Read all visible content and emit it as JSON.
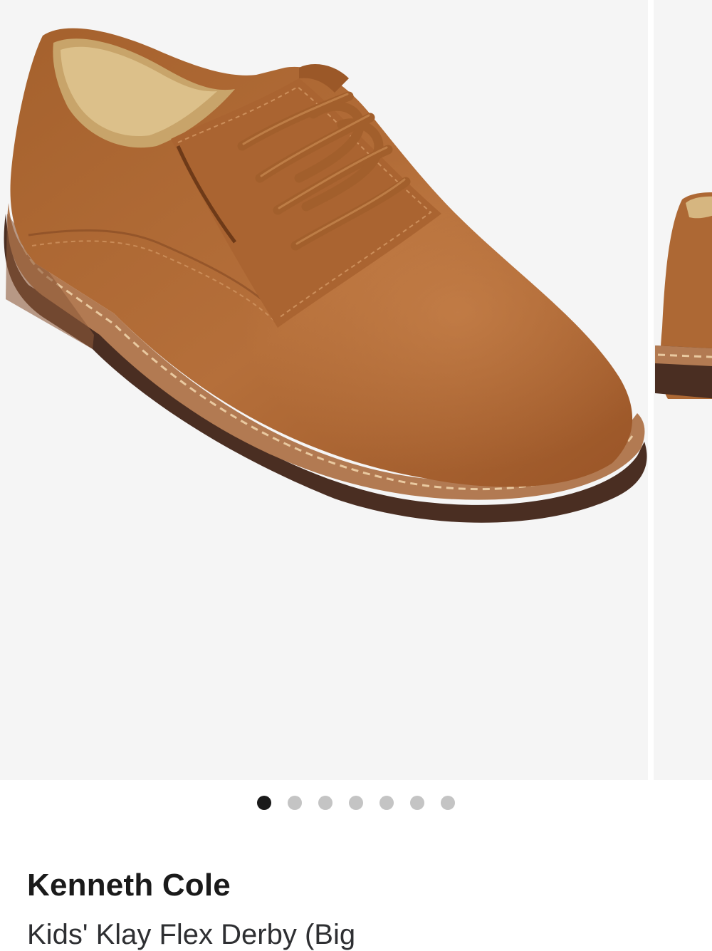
{
  "product": {
    "brand": "Kenneth Cole",
    "title": "Kids' Klay Flex Derby (Big"
  },
  "gallery": {
    "image_count": 7,
    "active_index": 0,
    "image_subject": "shoe-product-photo",
    "upper_color": "#b06a35",
    "sole_color": "#4a2e22",
    "background_color": "#f5f5f5"
  },
  "colors": {
    "dot_active": "#1a1a1a",
    "dot_inactive": "#c4c4c4",
    "text": "#1a1a1a"
  }
}
